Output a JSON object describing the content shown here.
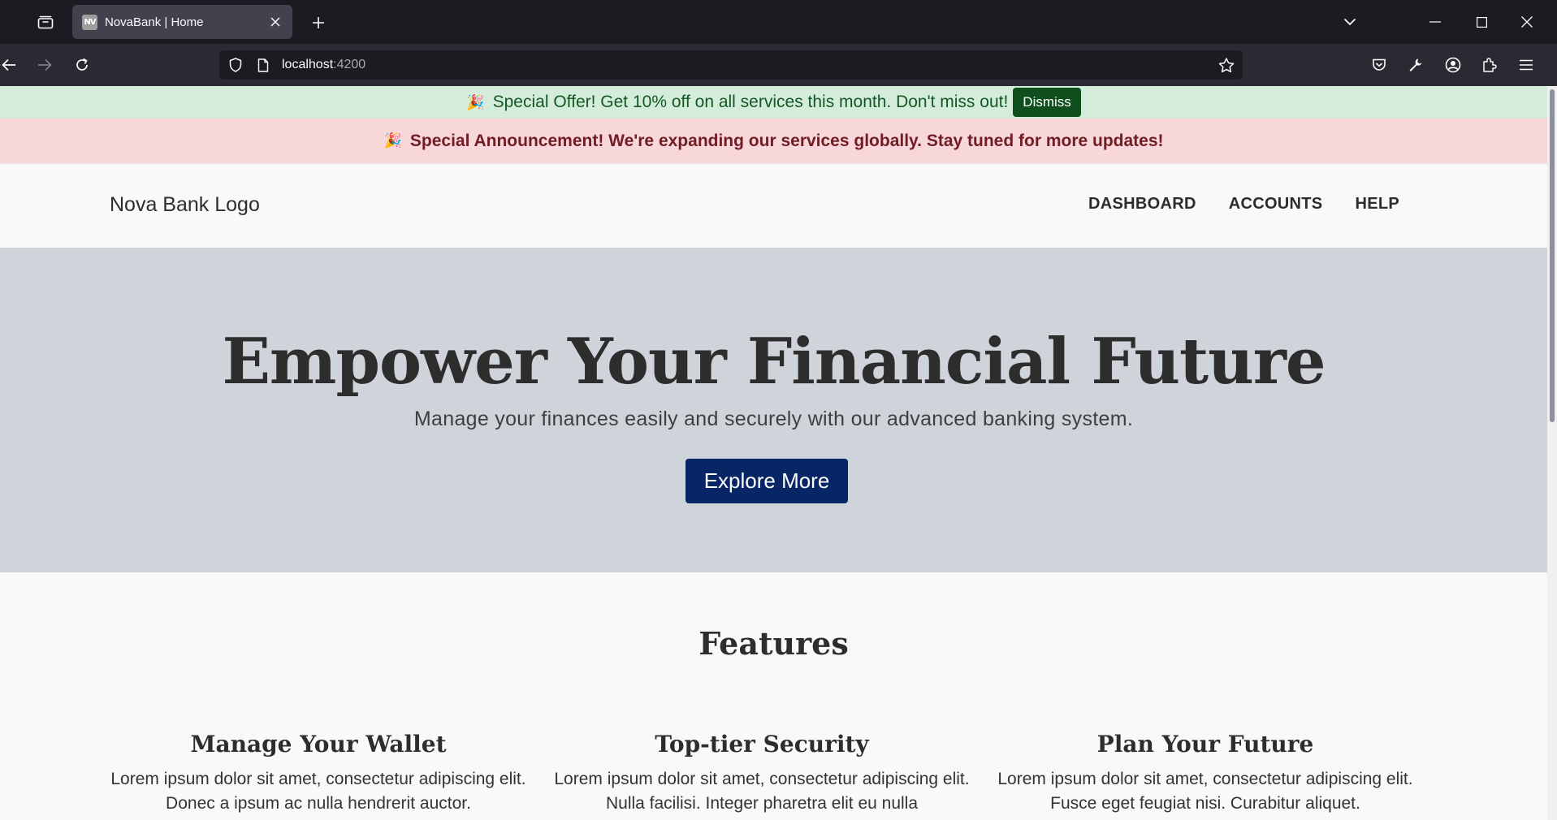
{
  "browser": {
    "tab": {
      "favicon_text": "NV",
      "title": "NovaBank | Home"
    },
    "url": {
      "host": "localhost",
      "port": ":4200"
    },
    "icons": [
      "tab-overview-icon",
      "close-icon",
      "plus-icon",
      "chevron-down-icon",
      "minimize-icon",
      "maximize-icon",
      "close-window-icon",
      "back-icon",
      "forward-icon",
      "reload-icon",
      "shield-icon",
      "page-icon",
      "star-icon",
      "pocket-icon",
      "wrench-icon",
      "account-icon",
      "extensions-icon",
      "menu-icon"
    ]
  },
  "offer": {
    "emoji": "🎉",
    "text": "Special Offer! Get 10% off on all services this month. Don't miss out!",
    "dismiss_label": "Dismiss"
  },
  "announcement": {
    "emoji": "🎉",
    "text": "Special Announcement! We're expanding our services globally. Stay tuned for more updates!"
  },
  "header": {
    "logo": "Nova Bank Logo",
    "nav": [
      "DASHBOARD",
      "ACCOUNTS",
      "HELP"
    ]
  },
  "hero": {
    "title": "Empower Your Financial Future",
    "subtitle": "Manage your finances easily and securely with our advanced banking system.",
    "cta": "Explore More"
  },
  "features": {
    "heading": "Features",
    "items": [
      {
        "title": "Manage Your Wallet",
        "text": "Lorem ipsum dolor sit amet, consectetur adipiscing elit. Donec a ipsum ac nulla hendrerit auctor."
      },
      {
        "title": "Top-tier Security",
        "text": "Lorem ipsum dolor sit amet, consectetur adipiscing elit. Nulla facilisi. Integer pharetra elit eu nulla"
      },
      {
        "title": "Plan Your Future",
        "text": "Lorem ipsum dolor sit amet, consectetur adipiscing elit. Fusce eget feugiat nisi. Curabitur aliquet."
      }
    ]
  },
  "colors": {
    "offer_bg": "#d4eddb",
    "offer_text": "#155724",
    "dismiss_bg": "#0f4f1e",
    "announce_bg": "#f8d7da",
    "announce_text": "#721c24",
    "hero_bg": "#cfd4db",
    "cta_bg": "#082666"
  }
}
